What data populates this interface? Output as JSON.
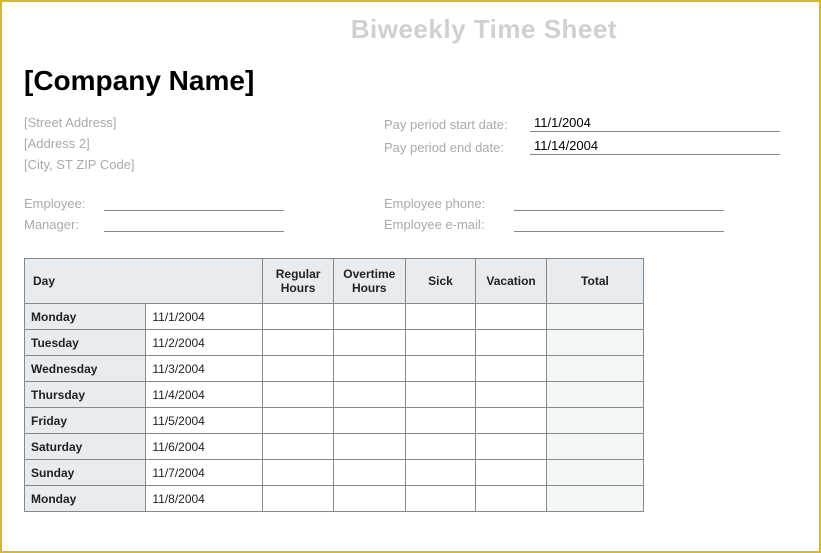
{
  "title": "Biweekly Time Sheet",
  "company_name": "[Company Name]",
  "address": {
    "street": "[Street Address]",
    "address2": "[Address 2]",
    "city_state_zip": "[City, ST  ZIP Code]"
  },
  "pay_period": {
    "start_label": "Pay period start date:",
    "start_value": "11/1/2004",
    "end_label": "Pay period end date:",
    "end_value": "11/14/2004"
  },
  "fields": {
    "employee_label": "Employee:",
    "manager_label": "Manager:",
    "phone_label": "Employee phone:",
    "email_label": "Employee e-mail:"
  },
  "table": {
    "headers": {
      "day": "Day",
      "regular": "Regular Hours",
      "overtime": "Overtime Hours",
      "sick": "Sick",
      "vacation": "Vacation",
      "total": "Total"
    },
    "rows": [
      {
        "day": "Monday",
        "date": "11/1/2004"
      },
      {
        "day": "Tuesday",
        "date": "11/2/2004"
      },
      {
        "day": "Wednesday",
        "date": "11/3/2004"
      },
      {
        "day": "Thursday",
        "date": "11/4/2004"
      },
      {
        "day": "Friday",
        "date": "11/5/2004"
      },
      {
        "day": "Saturday",
        "date": "11/6/2004"
      },
      {
        "day": "Sunday",
        "date": "11/7/2004"
      },
      {
        "day": "Monday",
        "date": "11/8/2004"
      }
    ]
  }
}
